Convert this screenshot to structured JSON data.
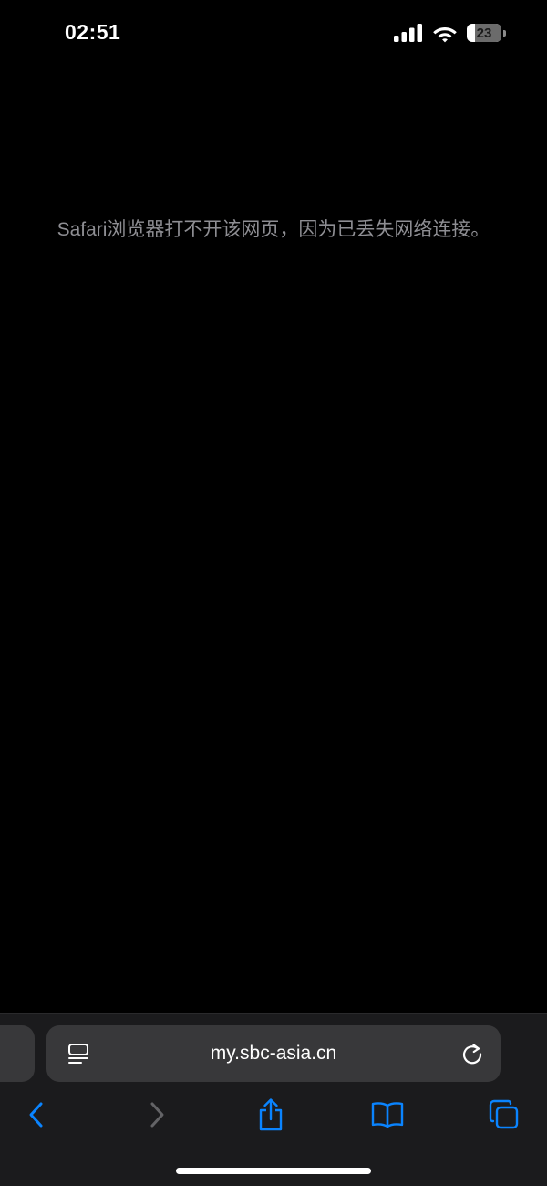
{
  "status_bar": {
    "time": "02:51",
    "battery_level": "23",
    "battery_fraction": 0.23,
    "icons": [
      "cellular-signal-icon",
      "wifi-icon",
      "battery-icon"
    ]
  },
  "page": {
    "error_message": "Safari浏览器打不开该网页，因为已丢失网络连接。"
  },
  "toolbar": {
    "address": "my.sbc-asia.cn",
    "icons": {
      "reader": "reader-format-icon",
      "reload": "reload-icon",
      "back": "back-chevron-icon",
      "forward": "forward-chevron-icon",
      "share": "share-icon",
      "bookmarks": "bookmarks-book-icon",
      "tabs": "tabs-overview-icon"
    }
  },
  "colors": {
    "accent": "#0a84ff",
    "disabled": "#636366",
    "message_text": "#8e8e93",
    "toolbar_bg": "#1b1b1d",
    "field_bg": "#38383a"
  }
}
